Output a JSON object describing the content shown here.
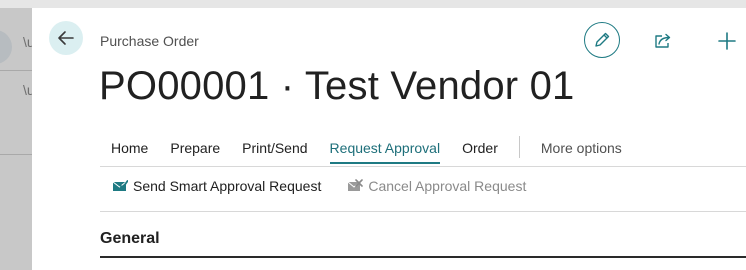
{
  "header": {
    "caption": "Purchase Order",
    "title": "PO00001 · Test Vendor 01"
  },
  "icons": {
    "back": "arrow-left-icon",
    "edit": "pencil-icon",
    "share": "share-icon",
    "new": "plus-icon"
  },
  "tabs": [
    {
      "label": "Home",
      "active": false
    },
    {
      "label": "Prepare",
      "active": false
    },
    {
      "label": "Print/Send",
      "active": false
    },
    {
      "label": "Request Approval",
      "active": true
    },
    {
      "label": "Order",
      "active": false
    }
  ],
  "more_options": "More options",
  "actions": [
    {
      "label": "Send Smart Approval Request",
      "enabled": true,
      "icon": "send-approval-icon"
    },
    {
      "label": "Cancel Approval Request",
      "enabled": false,
      "icon": "cancel-approval-icon"
    }
  ],
  "section": {
    "title": "General"
  },
  "colors": {
    "accent": "#1e7a83",
    "back_button_bg": "#dbeff1",
    "disabled_text": "#8a8a8a"
  }
}
